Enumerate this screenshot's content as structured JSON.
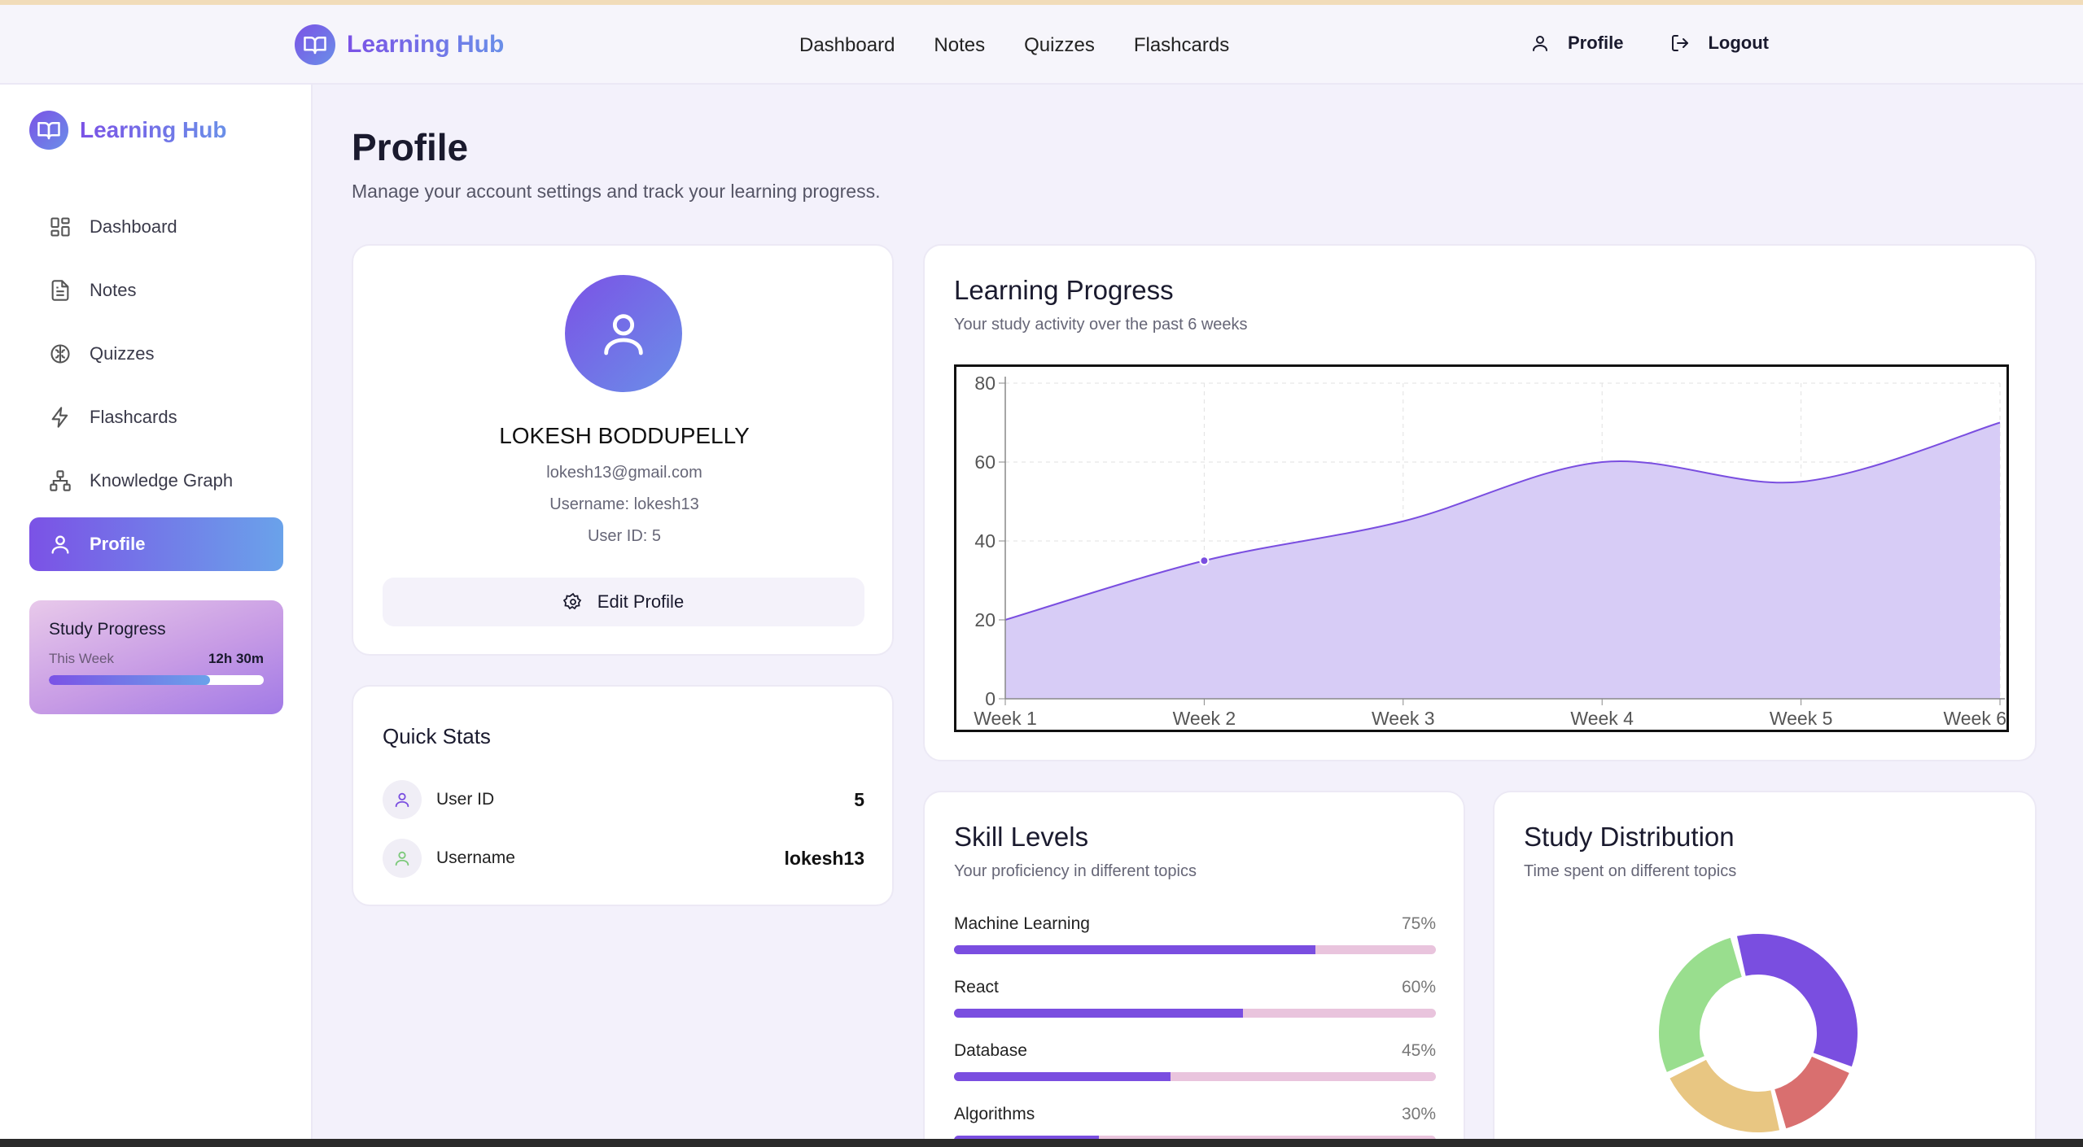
{
  "brand": {
    "name": "Learning Hub"
  },
  "topnav": {
    "links": [
      "Dashboard",
      "Notes",
      "Quizzes",
      "Flashcards"
    ],
    "profile_label": "Profile",
    "logout_label": "Logout"
  },
  "sidebar": {
    "items": [
      {
        "label": "Dashboard",
        "icon": "dashboard-icon"
      },
      {
        "label": "Notes",
        "icon": "notes-icon"
      },
      {
        "label": "Quizzes",
        "icon": "brain-icon"
      },
      {
        "label": "Flashcards",
        "icon": "lightning-icon"
      },
      {
        "label": "Knowledge Graph",
        "icon": "graph-icon"
      },
      {
        "label": "Profile",
        "icon": "user-icon",
        "active": true
      }
    ],
    "study_progress": {
      "title": "Study Progress",
      "period": "This Week",
      "time": "12h 30m",
      "fraction": 0.75
    }
  },
  "page": {
    "title": "Profile",
    "subtitle": "Manage your account settings and track your learning progress."
  },
  "profile": {
    "name": "LOKESH BODDUPELLY",
    "email": "lokesh13@gmail.com",
    "username_line": "Username: lokesh13",
    "userid_line": "User ID: 5",
    "edit_label": "Edit Profile"
  },
  "quick_stats": {
    "title": "Quick Stats",
    "rows": [
      {
        "label": "User ID",
        "value": "5",
        "icon": "user-icon",
        "icon_color": "#7a4ee0"
      },
      {
        "label": "Username",
        "value": "lokesh13",
        "icon": "user-icon",
        "icon_color": "#7cc97a"
      }
    ]
  },
  "learning_progress": {
    "title": "Learning Progress",
    "subtitle": "Your study activity over the past 6 weeks"
  },
  "chart_data": {
    "type": "area",
    "title": "Learning Progress",
    "subtitle": "Your study activity over the past 6 weeks",
    "categories": [
      "Week 1",
      "Week 2",
      "Week 3",
      "Week 4",
      "Week 5",
      "Week 6"
    ],
    "series": [
      {
        "values": [
          20,
          35,
          45,
          60,
          55,
          70
        ]
      }
    ],
    "ylim": [
      0,
      80
    ],
    "yticks": [
      0,
      20,
      40,
      60,
      80
    ],
    "grid": true,
    "colors": {
      "fill": "#d7ccf6",
      "line": "#7a4ee0",
      "grid": "#e2e2e2",
      "axis": "#888888"
    }
  },
  "skills": {
    "title": "Skill Levels",
    "subtitle": "Your proficiency in different topics",
    "items": [
      {
        "name": "Machine Learning",
        "percent_label": "75%",
        "value": 75
      },
      {
        "name": "React",
        "percent_label": "60%",
        "value": 60
      },
      {
        "name": "Database",
        "percent_label": "45%",
        "value": 45
      },
      {
        "name": "Algorithms",
        "percent_label": "30%",
        "value": 30
      }
    ]
  },
  "distribution": {
    "title": "Study Distribution",
    "subtitle": "Time spent on different topics",
    "slices": [
      {
        "value": 35,
        "color": "#7a4ee0"
      },
      {
        "value": 15,
        "color": "#d96f6f"
      },
      {
        "value": 22,
        "color": "#e8c682"
      },
      {
        "value": 28,
        "color": "#99de8e"
      }
    ]
  }
}
